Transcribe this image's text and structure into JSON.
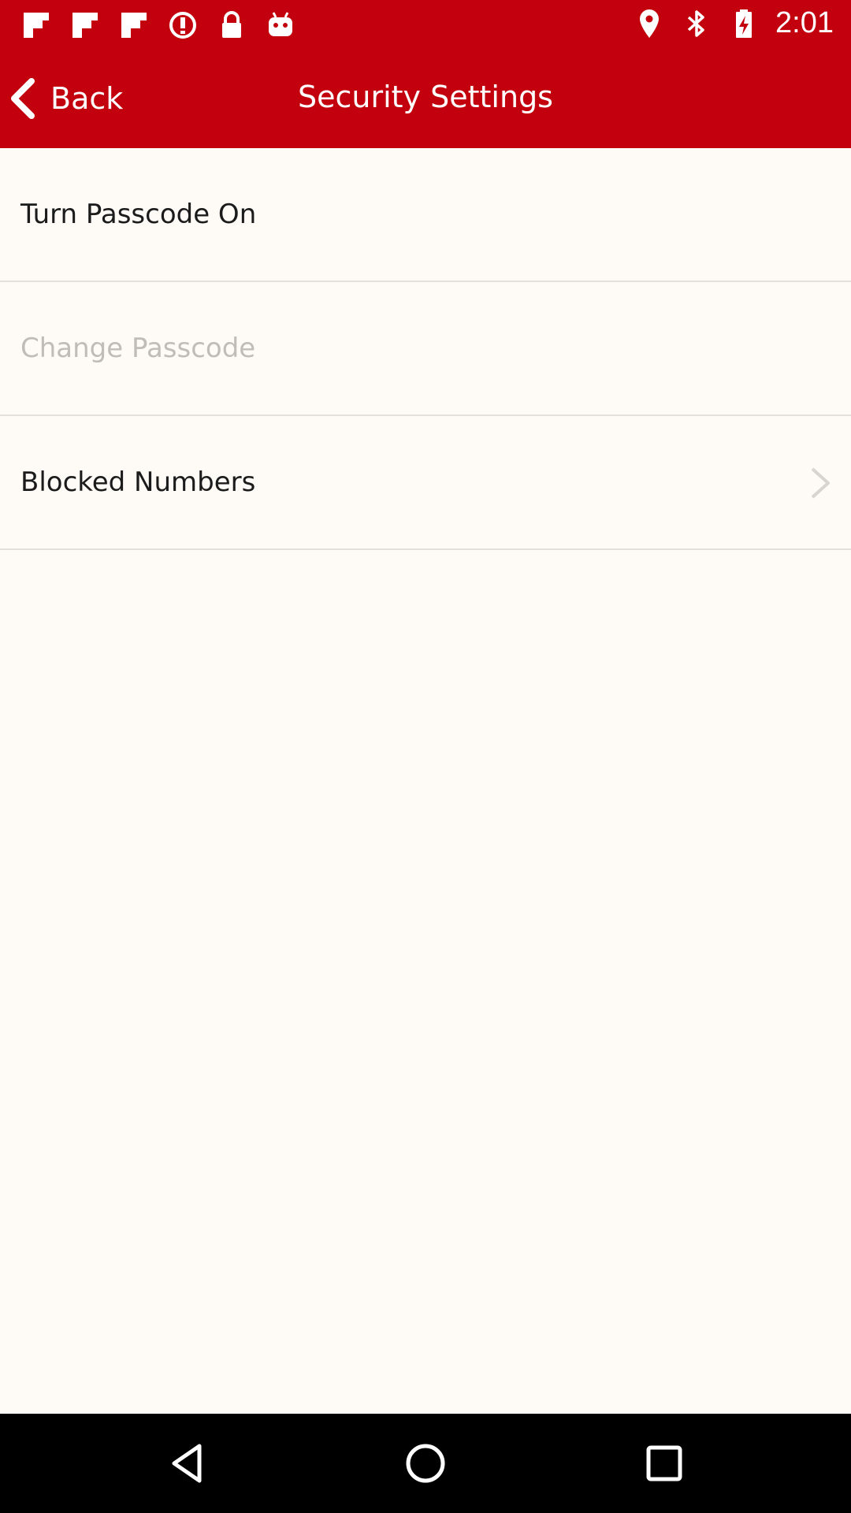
{
  "status_bar": {
    "time": "2:01",
    "left_icons": [
      "flipboard-icon",
      "flipboard-icon",
      "flipboard-icon",
      "alert-circle-icon",
      "lock-icon",
      "android-icon"
    ],
    "right_icons": [
      "location-pin-icon",
      "bluetooth-icon",
      "battery-charging-icon"
    ]
  },
  "app_bar": {
    "back_label": "Back",
    "title": "Security Settings",
    "background_color": "#c3000d"
  },
  "settings": {
    "items": [
      {
        "label": "Turn Passcode On",
        "enabled": true,
        "has_chevron": false
      },
      {
        "label": "Change Passcode",
        "enabled": false,
        "has_chevron": false
      },
      {
        "label": "Blocked Numbers",
        "enabled": true,
        "has_chevron": true
      }
    ]
  },
  "nav_bar": {
    "buttons": [
      "back-triangle-icon",
      "home-circle-icon",
      "recents-square-icon"
    ]
  }
}
